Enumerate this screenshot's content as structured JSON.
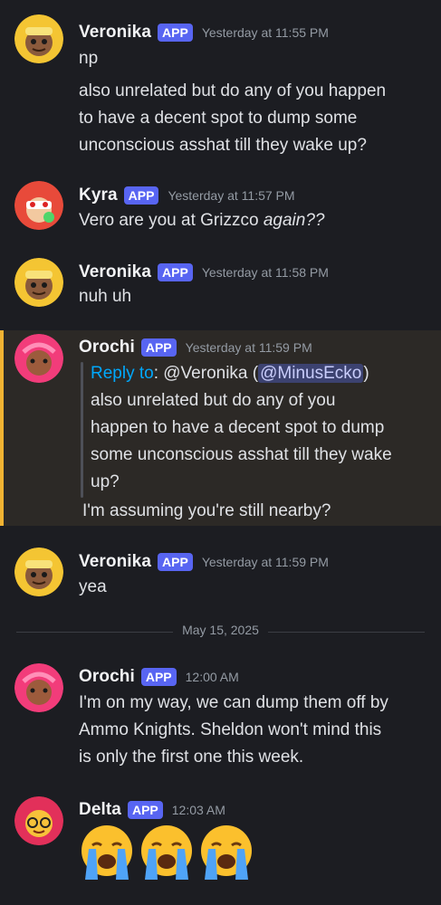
{
  "messages": [
    {
      "author": "Veronika",
      "badge": "APP",
      "time": "Yesterday at 11:55 PM",
      "lines": [
        "np",
        "also unrelated but do any of you happen",
        "to have a decent spot to dump some",
        "unconscious asshat till they wake up?"
      ]
    },
    {
      "author": "Kyra",
      "badge": "APP",
      "time": "Yesterday at 11:57 PM",
      "text_plain": "Vero are you at Grizzco ",
      "text_italic": "again??"
    },
    {
      "author": "Veronika",
      "badge": "APP",
      "time": "Yesterday at 11:58 PM",
      "lines": [
        "nuh uh"
      ]
    },
    {
      "author": "Orochi",
      "badge": "APP",
      "time": "Yesterday at 11:59 PM",
      "reply_label": "Reply to",
      "reply_colon": ": @Veronika (",
      "reply_mention": "@MinusEcko",
      "reply_close": ")",
      "quote_lines": [
        "also unrelated but do any of you",
        "happen to have a decent spot to dump",
        "some unconscious asshat till they wake",
        "up?"
      ],
      "lines": [
        "I'm assuming you're still nearby?"
      ]
    },
    {
      "author": "Veronika",
      "badge": "APP",
      "time": "Yesterday at 11:59 PM",
      "lines": [
        "yea"
      ]
    },
    {
      "author": "Orochi",
      "badge": "APP",
      "time": "12:00 AM",
      "lines": [
        "I'm on my way, we can dump them off by",
        "Ammo Knights. Sheldon won't mind this",
        "is only the first one this week."
      ]
    },
    {
      "author": "Delta",
      "badge": "APP",
      "time": "12:03 AM",
      "emoji": [
        "loudly-crying-face",
        "loudly-crying-face",
        "loudly-crying-face"
      ]
    }
  ],
  "date_divider": "May 15, 2025",
  "colors": {
    "background": "#1c1d22",
    "badge": "#5865f2",
    "highlight": "#2c2926",
    "highlight_bar": "#f0b232",
    "link": "#00a8fc"
  }
}
